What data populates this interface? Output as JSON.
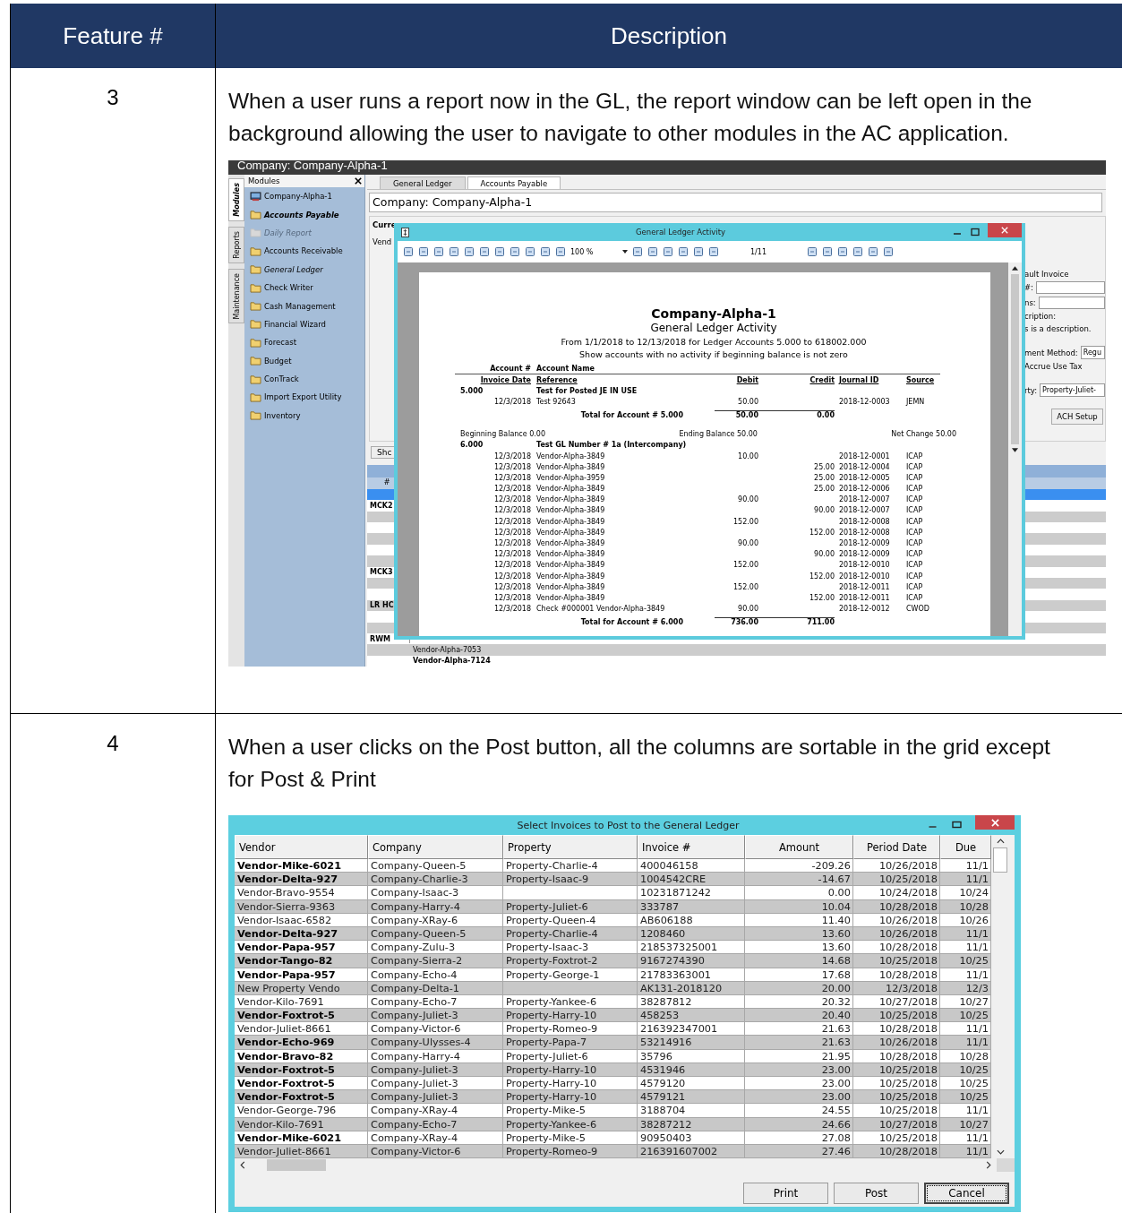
{
  "table": {
    "columns": [
      "Feature #",
      "Description"
    ],
    "rows": [
      {
        "feature": "3",
        "description": "When a user runs a report now in the GL, the report window can be left open in the background allowing the user to navigate to other modules in the AC application.",
        "screenshot": {
          "title": "Company: Company-Alpha-1",
          "side_tabs": [
            {
              "label": "Modules",
              "selected": true
            },
            {
              "label": "Reports",
              "selected": false
            },
            {
              "label": "Maintenance",
              "selected": false
            }
          ],
          "modules_header": "Modules",
          "modules": [
            {
              "label": "Company-Alpha-1",
              "kind": "company"
            },
            {
              "label": "Accounts Payable",
              "kind": "active"
            },
            {
              "label": "Daily Report",
              "kind": "disabled"
            },
            {
              "label": "Accounts Receivable",
              "kind": "folder"
            },
            {
              "label": "General Ledger",
              "kind": "open"
            },
            {
              "label": "Check Writer",
              "kind": "folder"
            },
            {
              "label": "Cash Management",
              "kind": "folder"
            },
            {
              "label": "Financial Wizard",
              "kind": "folder"
            },
            {
              "label": "Forecast",
              "kind": "folder"
            },
            {
              "label": "Budget",
              "kind": "folder"
            },
            {
              "label": "ConTrack",
              "kind": "folder"
            },
            {
              "label": "Import Export Utility",
              "kind": "folder"
            },
            {
              "label": "Inventory",
              "kind": "folder"
            }
          ],
          "tabs": [
            {
              "label": "General Ledger",
              "selected": false
            },
            {
              "label": "Accounts Payable",
              "selected": true
            }
          ],
          "company": "Company: Company-Alpha-1",
          "form_labels": [
            "Curre",
            "Vend"
          ],
          "right_panel": {
            "group": "ault Invoice",
            "number_label": "#:",
            "terms_label": "ns:",
            "description_label": "cription:",
            "description_value": "s is a description.",
            "method_label": "ment Method:",
            "method_value": "Regu",
            "accrue": "Accrue Use Tax",
            "property_label": "rty:",
            "property_value": "Property-Juliet-",
            "button": "ACH Setup"
          },
          "show_button": "Shc",
          "grid_column": "#",
          "grid_rows": [
            {
              "selected": true
            },
            {
              "selected": false,
              "code": "MCK2"
            },
            {
              "selected": false
            },
            {
              "selected": false
            },
            {
              "selected": false
            },
            {
              "selected": false
            },
            {
              "selected": false
            },
            {
              "selected": false,
              "code": "MCK3"
            },
            {
              "selected": false
            },
            {
              "selected": false
            },
            {
              "selected": false,
              "code": "LR HC"
            },
            {
              "selected": false
            },
            {
              "selected": false
            },
            {
              "selected": false,
              "code": "RWM"
            },
            {
              "selected": false,
              "vendor": "Vendor-Alpha-7053",
              "bold": false
            },
            {
              "selected": false,
              "vendor": "Vendor-Alpha-7124",
              "bold": true
            }
          ],
          "report_window": {
            "title": "General Ledger Activity",
            "zoom": "100 %",
            "page": "1/11",
            "company": "Company-Alpha-1",
            "subtitle": "General Ledger Activity",
            "range": "From 1/1/2018 to 12/13/2018 for Ledger Accounts 5.000 to 618002.000",
            "note": "Show accounts with no activity if beginning balance is not zero",
            "header_top": [
              "Account #",
              "Account Name"
            ],
            "header_bottom": [
              "Invoice Date",
              "Reference",
              "Debit",
              "Credit",
              "Journal ID",
              "Source"
            ],
            "accounts": [
              {
                "number": "5.000",
                "name": "Test for Posted JE IN USE",
                "lines": [
                  {
                    "date": "12/3/2018",
                    "reference": "Test 92643",
                    "debit": "50.00",
                    "journal": "2018-12-0003",
                    "source": "JEMN"
                  }
                ],
                "total_label": "Total for Account # 5.000",
                "total_debit": "50.00",
                "total_credit": "0.00",
                "balances": [
                  "Beginning Balance 0.00",
                  "Ending Balance 50.00",
                  "Net Change 50.00"
                ]
              },
              {
                "number": "6.000",
                "name": "Test GL Number # 1a (Intercompany)",
                "lines": [
                  {
                    "date": "12/3/2018",
                    "reference": "Vendor-Alpha-3849",
                    "debit": "10.00",
                    "journal": "2018-12-0001",
                    "source": "ICAP"
                  },
                  {
                    "date": "12/3/2018",
                    "reference": "Vendor-Alpha-3849",
                    "credit": "25.00",
                    "journal": "2018-12-0004",
                    "source": "ICAP"
                  },
                  {
                    "date": "12/3/2018",
                    "reference": "Vendor-Alpha-3959",
                    "credit": "25.00",
                    "journal": "2018-12-0005",
                    "source": "ICAP"
                  },
                  {
                    "date": "12/3/2018",
                    "reference": "Vendor-Alpha-3849",
                    "credit": "25.00",
                    "journal": "2018-12-0006",
                    "source": "ICAP"
                  },
                  {
                    "date": "12/3/2018",
                    "reference": "Vendor-Alpha-3849",
                    "debit": "90.00",
                    "journal": "2018-12-0007",
                    "source": "ICAP"
                  },
                  {
                    "date": "12/3/2018",
                    "reference": "Vendor-Alpha-3849",
                    "credit": "90.00",
                    "journal": "2018-12-0007",
                    "source": "ICAP"
                  },
                  {
                    "date": "12/3/2018",
                    "reference": "Vendor-Alpha-3849",
                    "debit": "152.00",
                    "journal": "2018-12-0008",
                    "source": "ICAP"
                  },
                  {
                    "date": "12/3/2018",
                    "reference": "Vendor-Alpha-3849",
                    "credit": "152.00",
                    "journal": "2018-12-0008",
                    "source": "ICAP"
                  },
                  {
                    "date": "12/3/2018",
                    "reference": "Vendor-Alpha-3849",
                    "debit": "90.00",
                    "journal": "2018-12-0009",
                    "source": "ICAP"
                  },
                  {
                    "date": "12/3/2018",
                    "reference": "Vendor-Alpha-3849",
                    "credit": "90.00",
                    "journal": "2018-12-0009",
                    "source": "ICAP"
                  },
                  {
                    "date": "12/3/2018",
                    "reference": "Vendor-Alpha-3849",
                    "debit": "152.00",
                    "journal": "2018-12-0010",
                    "source": "ICAP"
                  },
                  {
                    "date": "12/3/2018",
                    "reference": "Vendor-Alpha-3849",
                    "credit": "152.00",
                    "journal": "2018-12-0010",
                    "source": "ICAP"
                  },
                  {
                    "date": "12/3/2018",
                    "reference": "Vendor-Alpha-3849",
                    "debit": "152.00",
                    "journal": "2018-12-0011",
                    "source": "ICAP"
                  },
                  {
                    "date": "12/3/2018",
                    "reference": "Vendor-Alpha-3849",
                    "credit": "152.00",
                    "journal": "2018-12-0011",
                    "source": "ICAP"
                  },
                  {
                    "date": "12/3/2018",
                    "reference": "Check #000001 Vendor-Alpha-3849",
                    "debit": "90.00",
                    "journal": "2018-12-0012",
                    "source": "CWOD"
                  }
                ],
                "total_label": "Total for Account # 6.000",
                "total_debit": "736.00",
                "total_credit": "711.00"
              }
            ]
          }
        }
      },
      {
        "feature": "4",
        "description": "When a user clicks on the Post button, all the columns are sortable in the grid except for Post & Print",
        "dialog": {
          "title": "Select Invoices to Post to the General Ledger",
          "columns": [
            "Vendor",
            "Company",
            "Property",
            "Invoice #",
            "Amount",
            "Period Date",
            "Due"
          ],
          "rows": [
            {
              "bold": true,
              "cells": [
                "Vendor-Mike-6021",
                "Company-Queen-5",
                "Property-Charlie-4",
                "400046158",
                "-209.26",
                "10/26/2018",
                "11/1"
              ]
            },
            {
              "bold": true,
              "cells": [
                "Vendor-Delta-927",
                "Company-Charlie-3",
                "Property-Isaac-9",
                "1004542CRE",
                "-14.67",
                "10/25/2018",
                "11/1"
              ]
            },
            {
              "bold": false,
              "cells": [
                "Vendor-Bravo-9554",
                "Company-Isaac-3",
                "",
                "10231871242",
                "0.00",
                "10/24/2018",
                "10/24"
              ]
            },
            {
              "bold": false,
              "cells": [
                "Vendor-Sierra-9363",
                "Company-Harry-4",
                "Property-Juliet-6",
                "333787",
                "10.04",
                "10/28/2018",
                "10/28"
              ]
            },
            {
              "bold": false,
              "cells": [
                "Vendor-Isaac-6582",
                "Company-XRay-6",
                "Property-Queen-4",
                "AB606188",
                "11.40",
                "10/26/2018",
                "10/26"
              ]
            },
            {
              "bold": true,
              "cells": [
                "Vendor-Delta-927",
                "Company-Queen-5",
                "Property-Charlie-4",
                "1208460",
                "13.60",
                "10/26/2018",
                "11/1"
              ]
            },
            {
              "bold": true,
              "cells": [
                "Vendor-Papa-957",
                "Company-Zulu-3",
                "Property-Isaac-3",
                "218537325001",
                "13.60",
                "10/28/2018",
                "11/1"
              ]
            },
            {
              "bold": true,
              "cells": [
                "Vendor-Tango-82",
                "Company-Sierra-2",
                "Property-Foxtrot-2",
                "9167274390",
                "14.68",
                "10/25/2018",
                "10/25"
              ]
            },
            {
              "bold": true,
              "cells": [
                "Vendor-Papa-957",
                "Company-Echo-4",
                "Property-George-1",
                "21783363001",
                "17.68",
                "10/28/2018",
                "11/1"
              ]
            },
            {
              "bold": false,
              "cells": [
                "New Property Vendo",
                "Company-Delta-1",
                "",
                "AK131-2018120",
                "20.00",
                "12/3/2018",
                "12/3"
              ]
            },
            {
              "bold": false,
              "cells": [
                "Vendor-Kilo-7691",
                "Company-Echo-7",
                "Property-Yankee-6",
                "38287812",
                "20.32",
                "10/27/2018",
                "10/27"
              ]
            },
            {
              "bold": true,
              "cells": [
                "Vendor-Foxtrot-5",
                "Company-Juliet-3",
                "Property-Harry-10",
                "458253",
                "20.40",
                "10/25/2018",
                "10/25"
              ]
            },
            {
              "bold": false,
              "cells": [
                "Vendor-Juliet-8661",
                "Company-Victor-6",
                "Property-Romeo-9",
                "216392347001",
                "21.63",
                "10/28/2018",
                "11/1"
              ]
            },
            {
              "bold": true,
              "cells": [
                "Vendor-Echo-969",
                "Company-Ulysses-4",
                "Property-Papa-7",
                "53214916",
                "21.63",
                "10/26/2018",
                "11/1"
              ]
            },
            {
              "bold": true,
              "cells": [
                "Vendor-Bravo-82",
                "Company-Harry-4",
                "Property-Juliet-6",
                "35796",
                "21.95",
                "10/28/2018",
                "10/28"
              ]
            },
            {
              "bold": true,
              "cells": [
                "Vendor-Foxtrot-5",
                "Company-Juliet-3",
                "Property-Harry-10",
                "4531946",
                "23.00",
                "10/25/2018",
                "10/25"
              ]
            },
            {
              "bold": true,
              "cells": [
                "Vendor-Foxtrot-5",
                "Company-Juliet-3",
                "Property-Harry-10",
                "4579120",
                "23.00",
                "10/25/2018",
                "10/25"
              ]
            },
            {
              "bold": true,
              "cells": [
                "Vendor-Foxtrot-5",
                "Company-Juliet-3",
                "Property-Harry-10",
                "4579121",
                "23.00",
                "10/25/2018",
                "10/25"
              ]
            },
            {
              "bold": false,
              "cells": [
                "Vendor-George-796",
                "Company-XRay-4",
                "Property-Mike-5",
                "3188704",
                "24.55",
                "10/25/2018",
                "11/1"
              ]
            },
            {
              "bold": false,
              "cells": [
                "Vendor-Kilo-7691",
                "Company-Echo-7",
                "Property-Yankee-6",
                "38287212",
                "24.66",
                "10/27/2018",
                "10/27"
              ]
            },
            {
              "bold": true,
              "cells": [
                "Vendor-Mike-6021",
                "Company-XRay-4",
                "Property-Mike-5",
                "90950403",
                "27.08",
                "10/25/2018",
                "11/1"
              ]
            },
            {
              "bold": false,
              "cells": [
                "Vendor-Juliet-8661",
                "Company-Victor-6",
                "Property-Romeo-9",
                "216391607002",
                "27.46",
                "10/28/2018",
                "11/1"
              ]
            }
          ],
          "buttons": [
            {
              "label": "Print",
              "focused": false
            },
            {
              "label": "Post",
              "focused": false
            },
            {
              "label": "Cancel",
              "focused": true
            }
          ]
        }
      }
    ]
  }
}
